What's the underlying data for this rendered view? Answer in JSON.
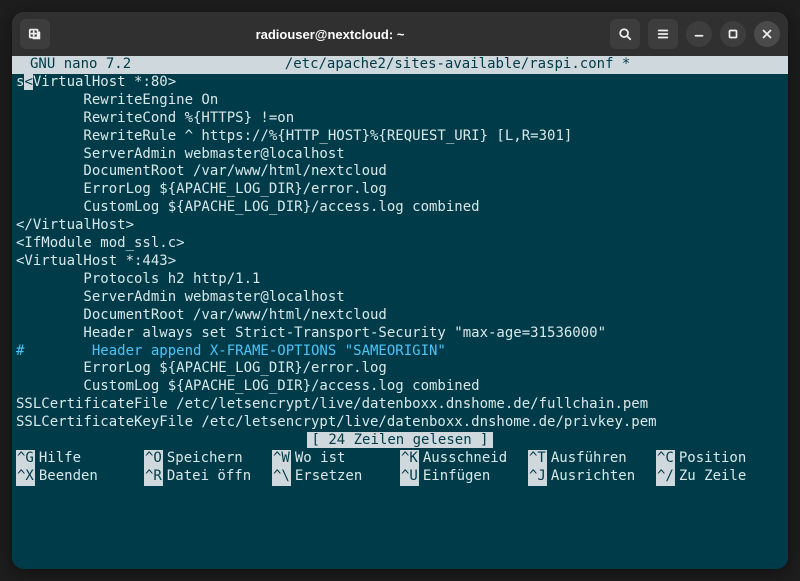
{
  "window": {
    "title": "radiouser@nextcloud: ~"
  },
  "nano": {
    "app": "GNU nano 7.2",
    "file": "/etc/apache2/sites-available/raspi.conf *",
    "status": "[ 24 Zeilen gelesen ]",
    "overflow_prefix": "s",
    "lines": [
      "<VirtualHost *:80>",
      "        RewriteEngine On",
      "        RewriteCond %{HTTPS} !=on",
      "        RewriteRule ^ https://%{HTTP_HOST}%{REQUEST_URI} [L,R=301]",
      "        ServerAdmin webmaster@localhost",
      "        DocumentRoot /var/www/html/nextcloud",
      "        ErrorLog ${APACHE_LOG_DIR}/error.log",
      "        CustomLog ${APACHE_LOG_DIR}/access.log combined",
      "</VirtualHost>",
      "<IfModule mod_ssl.c>",
      "<VirtualHost *:443>",
      "        Protocols h2 http/1.1",
      "        ServerAdmin webmaster@localhost",
      "        DocumentRoot /var/www/html/nextcloud",
      "        Header always set Strict-Transport-Security \"max-age=31536000\"",
      "#        Header append X-FRAME-OPTIONS \"SAMEORIGIN\"",
      "        ErrorLog ${APACHE_LOG_DIR}/error.log",
      "        CustomLog ${APACHE_LOG_DIR}/access.log combined",
      "SSLCertificateFile /etc/letsencrypt/live/datenboxx.dnshome.de/fullchain.pem",
      "SSLCertificateKeyFile /etc/letsencrypt/live/datenboxx.dnshome.de/privkey.pem"
    ],
    "comment_line_index": 15,
    "shortcuts_row1": [
      {
        "key": "^G",
        "label": "Hilfe"
      },
      {
        "key": "^O",
        "label": "Speichern"
      },
      {
        "key": "^W",
        "label": "Wo ist"
      },
      {
        "key": "^K",
        "label": "Ausschneid"
      },
      {
        "key": "^T",
        "label": "Ausführen"
      },
      {
        "key": "^C",
        "label": "Position"
      }
    ],
    "shortcuts_row2": [
      {
        "key": "^X",
        "label": "Beenden"
      },
      {
        "key": "^R",
        "label": "Datei öffn"
      },
      {
        "key": "^\\",
        "label": "Ersetzen"
      },
      {
        "key": "^U",
        "label": "Einfügen"
      },
      {
        "key": "^J",
        "label": "Ausrichten"
      },
      {
        "key": "^/",
        "label": "Zu Zeile"
      }
    ]
  }
}
